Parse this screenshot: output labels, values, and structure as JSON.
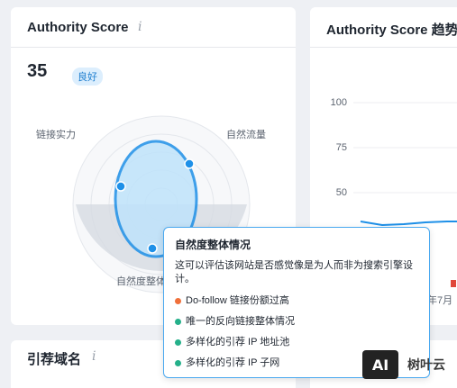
{
  "authority_card": {
    "title": "Authority Score",
    "info_icon": "i",
    "score": "35",
    "badge": "良好",
    "radar": {
      "label_top_left": "链接实力",
      "label_top_right": "自然流量",
      "label_bottom": "自然度整体"
    }
  },
  "trend_card": {
    "title": "Authority Score 趋势",
    "y_ticks": [
      "100",
      "75",
      "50"
    ],
    "x_label_partial": "年7月"
  },
  "refdomains_card": {
    "title": "引荐域名",
    "info_icon": "i"
  },
  "tooltip": {
    "title": "自然度整体情况",
    "description": "这可以评估该网站是否感觉像是为人而非为搜索引擎设计。",
    "items": [
      {
        "label": "Do-follow 链接份额过高",
        "status_color": "#f0703a"
      },
      {
        "label": "唯一的反向链接整体情况",
        "status_color": "#25b08a"
      },
      {
        "label": "多样化的引荐 IP 地址池",
        "status_color": "#25b08a"
      },
      {
        "label": "多样化的引荐 IP 子网",
        "status_color": "#25b08a"
      }
    ]
  },
  "watermark": {
    "logo_text": "AI",
    "name": "树叶云"
  },
  "colors": {
    "accent_blue": "#1e90e8",
    "fill_blue": "#bfe3fb",
    "grey_area": "#d6dbe2",
    "flag_red": "#e0473a"
  }
}
